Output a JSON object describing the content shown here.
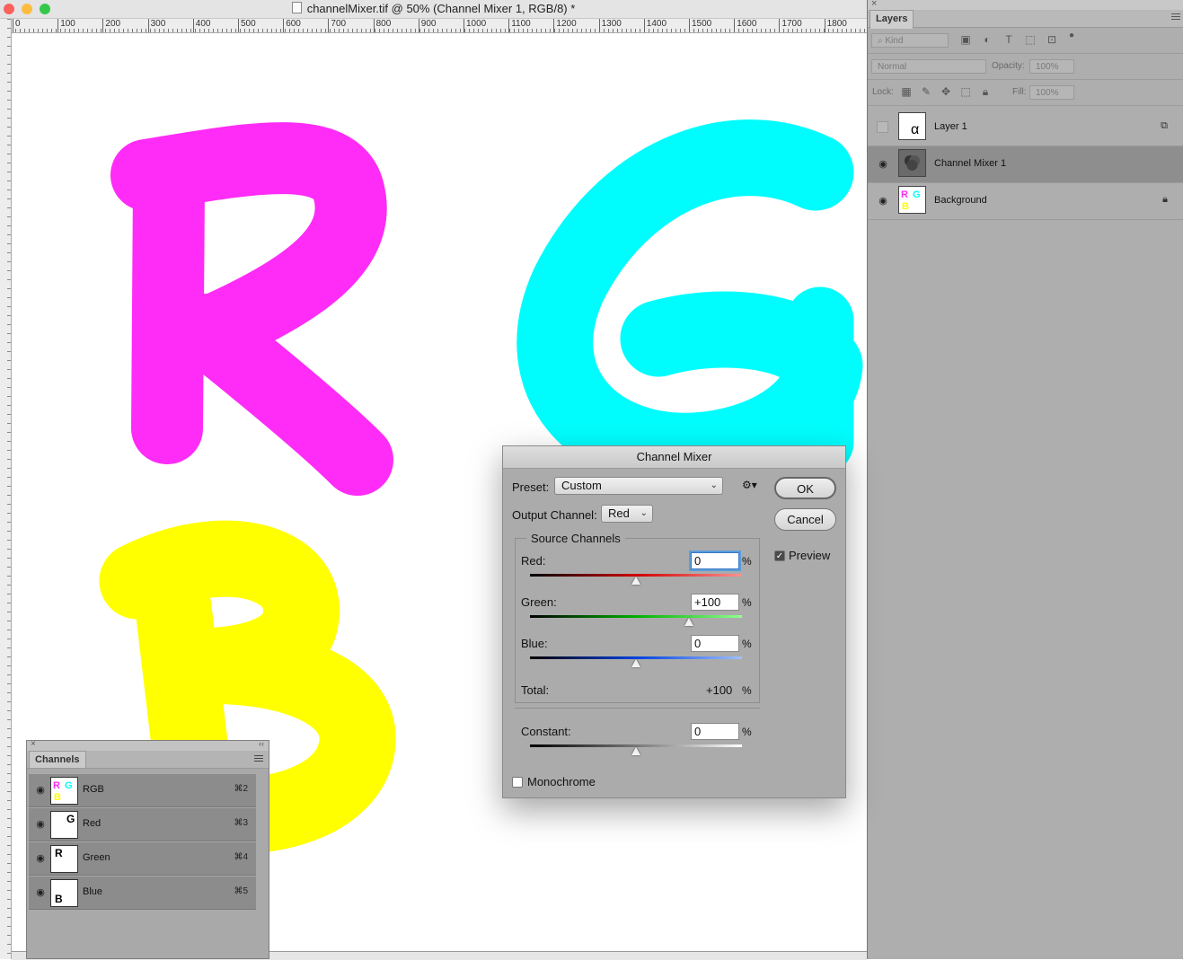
{
  "window": {
    "title": "channelMixer.tif @ 50% (Channel Mixer 1, RGB/8) *"
  },
  "colors": {
    "close": "#fc605c",
    "minimize": "#fdbc40",
    "zoom": "#34c84a",
    "magenta": "#ff2bf6",
    "cyan": "#00fdfd",
    "yellow": "#ffff00"
  },
  "ruler": {
    "ticks": [
      "0",
      "100",
      "200",
      "300",
      "400",
      "500",
      "600",
      "700",
      "800",
      "900",
      "1000",
      "1100",
      "1200",
      "1300",
      "1400",
      "1500",
      "1600",
      "1700",
      "1800"
    ]
  },
  "canvas": {
    "letters": [
      "R",
      "G",
      "B"
    ]
  },
  "layers_panel": {
    "tab": "Layers",
    "filter_kind": "Kind",
    "blend_mode": "Normal",
    "opacity_label": "Opacity:",
    "opacity_value": "100%",
    "lock_label": "Lock:",
    "fill_label": "Fill:",
    "fill_value": "100%",
    "layers": [
      {
        "name": "Layer 1",
        "visible": false,
        "selected": false,
        "thumb_glyph": "α"
      },
      {
        "name": "Channel Mixer 1",
        "visible": true,
        "selected": true
      },
      {
        "name": "Background",
        "visible": true,
        "selected": false,
        "locked": true
      }
    ]
  },
  "channels_panel": {
    "tab": "Channels",
    "channels": [
      {
        "name": "RGB",
        "shortcut": "⌘2"
      },
      {
        "name": "Red",
        "shortcut": "⌘3",
        "thumb_glyph": "G"
      },
      {
        "name": "Green",
        "shortcut": "⌘4",
        "thumb_glyph": "R"
      },
      {
        "name": "Blue",
        "shortcut": "⌘5",
        "thumb_glyph": "B"
      }
    ]
  },
  "mixer": {
    "title": "Channel Mixer",
    "preset_label": "Preset:",
    "preset_value": "Custom",
    "output_label": "Output Channel:",
    "output_value": "Red",
    "ok": "OK",
    "cancel": "Cancel",
    "preview_label": "Preview",
    "preview_checked": true,
    "source_title": "Source Channels",
    "red_label": "Red:",
    "red_value": "0",
    "green_label": "Green:",
    "green_value": "+100",
    "blue_label": "Blue:",
    "blue_value": "0",
    "total_label": "Total:",
    "total_value": "+100",
    "constant_label": "Constant:",
    "constant_value": "0",
    "percent": "%",
    "monochrome_label": "Monochrome",
    "monochrome_checked": false,
    "slider_levels": {
      "red": 0,
      "green": 100,
      "blue": 0,
      "constant": 0
    }
  }
}
